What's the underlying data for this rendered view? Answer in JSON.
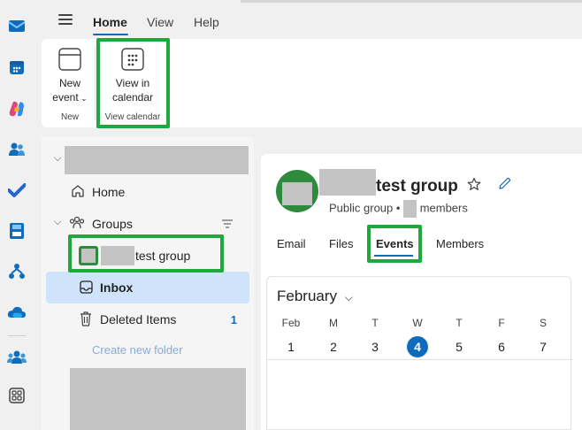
{
  "menu": {
    "tabs": [
      {
        "label": "Home",
        "active": true
      },
      {
        "label": "View",
        "active": false
      },
      {
        "label": "Help",
        "active": false
      }
    ]
  },
  "ribbon": {
    "new_event": {
      "line1": "New",
      "line2": "event",
      "group": "New"
    },
    "view_in_calendar": {
      "line1": "View in",
      "line2": "calendar",
      "group": "View calendar"
    }
  },
  "folder_pane": {
    "home": "Home",
    "groups": "Groups",
    "group_name_suffix": "test group",
    "inbox": "Inbox",
    "deleted_items": "Deleted Items",
    "deleted_count": "1",
    "create_folder": "Create new folder"
  },
  "group": {
    "title_suffix": "test group",
    "visibility": "Public group",
    "members_label": "members",
    "tabs": [
      "Email",
      "Files",
      "Events",
      "Members"
    ],
    "active_tab": "Events"
  },
  "calendar": {
    "month": "February",
    "day_names": [
      "Feb",
      "M",
      "T",
      "W",
      "T",
      "F",
      "S"
    ],
    "day_numbers": [
      "1",
      "2",
      "3",
      "4",
      "5",
      "6",
      "7"
    ],
    "today": "4"
  },
  "colors": {
    "accent": "#0f6cbd",
    "highlight": "#1fa83c",
    "avatar": "#2e8b3e",
    "selected": "#cfe4fa"
  }
}
